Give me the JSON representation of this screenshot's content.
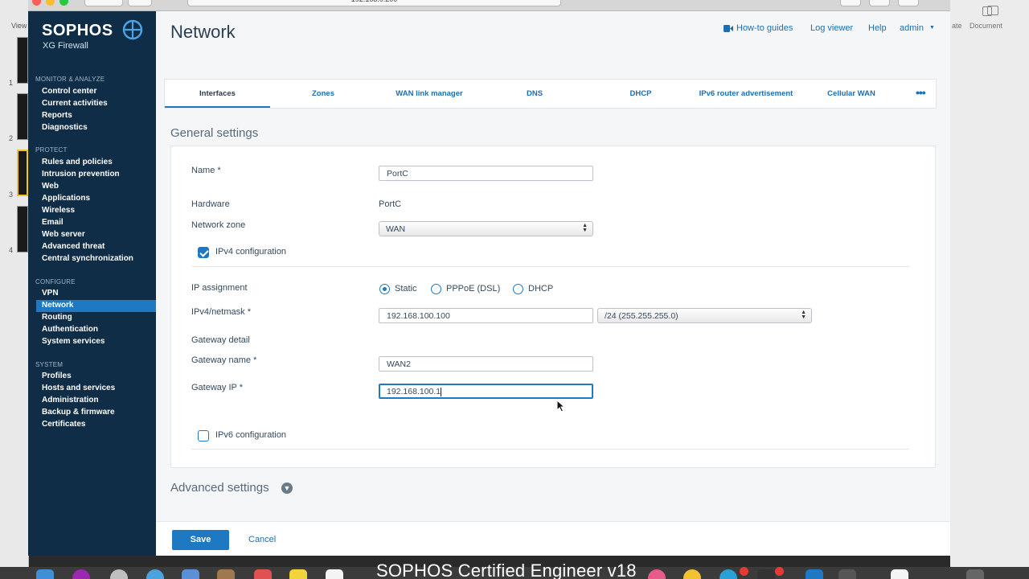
{
  "desktop": {
    "left_labels": [
      "View",
      "1",
      "2",
      "3",
      "4"
    ],
    "right_labels": [
      "ate",
      "Document"
    ],
    "watermark": "SOPHOS Certified Engineer v18"
  },
  "browser": {
    "url": "192.168.0.200"
  },
  "brand": {
    "logo": "SOPHOS",
    "product": "XG Firewall",
    "accent_color": "#1e78c2",
    "sidebar_color": "#0f2d47"
  },
  "sidebar": {
    "sections": [
      {
        "title": "MONITOR & ANALYZE",
        "items": [
          "Control center",
          "Current activities",
          "Reports",
          "Diagnostics"
        ]
      },
      {
        "title": "PROTECT",
        "items": [
          "Rules and policies",
          "Intrusion prevention",
          "Web",
          "Applications",
          "Wireless",
          "Email",
          "Web server",
          "Advanced threat",
          "Central synchronization"
        ]
      },
      {
        "title": "CONFIGURE",
        "items": [
          "VPN",
          "Network",
          "Routing",
          "Authentication",
          "System services"
        ]
      },
      {
        "title": "SYSTEM",
        "items": [
          "Profiles",
          "Hosts and services",
          "Administration",
          "Backup & firmware",
          "Certificates"
        ]
      }
    ],
    "active_item": "Network"
  },
  "header": {
    "title": "Network",
    "links": {
      "howto": "How-to guides",
      "log_viewer": "Log viewer",
      "help": "Help",
      "user": "admin"
    }
  },
  "tabs": [
    "Interfaces",
    "Zones",
    "WAN link manager",
    "DNS",
    "DHCP",
    "IPv6 router advertisement",
    "Cellular WAN"
  ],
  "active_tab": "Interfaces",
  "general": {
    "section_title": "General settings",
    "name_label": "Name *",
    "name_value": "PortC",
    "hardware_label": "Hardware",
    "hardware_value": "PortC",
    "zone_label": "Network zone",
    "zone_value": "WAN",
    "ipv4_label": "IPv4 configuration",
    "ipv4_checked": true,
    "ip_assign_label": "IP assignment",
    "ip_assign_options": [
      "Static",
      "PPPoE (DSL)",
      "DHCP"
    ],
    "ip_assign_selected": "Static",
    "ipv4_netmask_label": "IPv4/netmask *",
    "ipv4_value": "192.168.100.100",
    "netmask_value": "/24 (255.255.255.0)",
    "gateway_detail_label": "Gateway detail",
    "gateway_name_label": "Gateway name *",
    "gateway_name_value": "WAN2",
    "gateway_ip_label": "Gateway IP *",
    "gateway_ip_value": "192.168.100.1",
    "ipv6_label": "IPv6 configuration",
    "ipv6_checked": false
  },
  "advanced": {
    "section_title": "Advanced settings"
  },
  "footer": {
    "save": "Save",
    "cancel": "Cancel"
  }
}
